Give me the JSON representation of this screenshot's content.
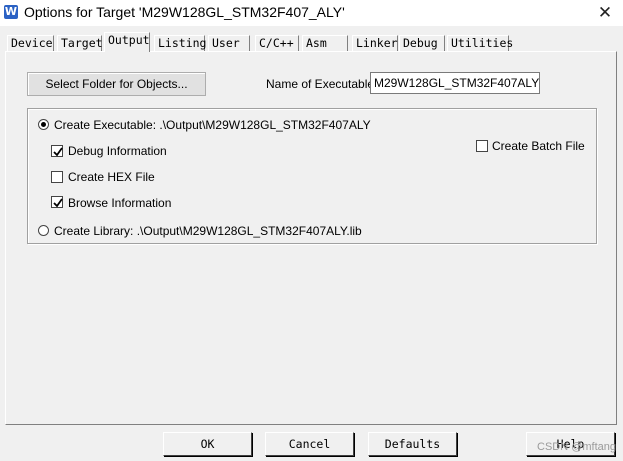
{
  "window": {
    "title": "Options for Target 'M29W128GL_STM32F407_ALY'",
    "icon_name": "keil-app-icon",
    "close_glyph": "✕"
  },
  "tabs": [
    {
      "label": "Device"
    },
    {
      "label": "Target"
    },
    {
      "label": "Output",
      "active": true
    },
    {
      "label": "Listing"
    },
    {
      "label": "User"
    },
    {
      "label": "C/C++"
    },
    {
      "label": "Asm"
    },
    {
      "label": "Linker"
    },
    {
      "label": "Debug"
    },
    {
      "label": "Utilities"
    }
  ],
  "output": {
    "select_folder_label": "Select Folder for Objects...",
    "name_of_executable_label": "Name of Executable:",
    "name_of_executable_value": "M29W128GL_STM32F407ALY",
    "create_executable_label": "Create Executable:  .\\Output\\M29W128GL_STM32F407ALY",
    "create_executable_checked": true,
    "debug_information_label": "Debug Information",
    "debug_information_checked": true,
    "create_hex_label": "Create HEX File",
    "create_hex_checked": false,
    "browse_information_label": "Browse Information",
    "browse_information_checked": true,
    "create_batch_label": "Create Batch File",
    "create_batch_checked": false,
    "create_library_label": "Create Library:  .\\Output\\M29W128GL_STM32F407ALY.lib",
    "create_library_checked": false
  },
  "footer": {
    "ok_label": "OK",
    "cancel_label": "Cancel",
    "defaults_label": "Defaults",
    "help_label": "Help"
  },
  "watermark": "CSDN @mftang"
}
